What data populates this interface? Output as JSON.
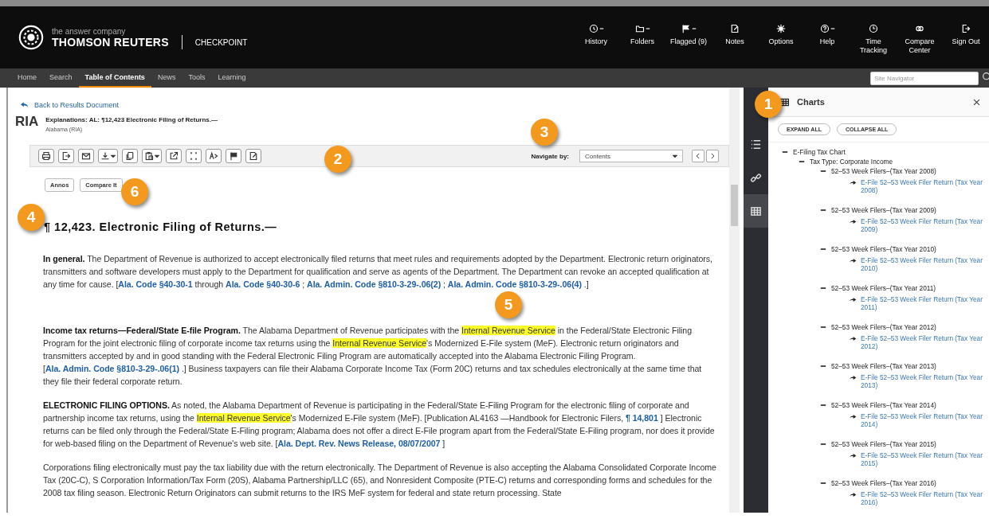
{
  "header": {
    "tagline": "the answer company",
    "brand": "THOMSON REUTERS",
    "product": "CHECKPOINT",
    "actions": [
      {
        "label": "History",
        "dropdown": true
      },
      {
        "label": "Folders",
        "dropdown": true
      },
      {
        "label": "Flagged (9)",
        "dropdown": true
      },
      {
        "label": "Notes",
        "dropdown": false
      },
      {
        "label": "Options",
        "dropdown": false
      },
      {
        "label": "Help",
        "dropdown": true
      },
      {
        "label": "Time Tracking",
        "dropdown": false
      },
      {
        "label": "Compare Center",
        "dropdown": false
      },
      {
        "label": "Sign Out",
        "dropdown": false
      }
    ]
  },
  "nav": {
    "tabs": [
      {
        "label": "Home",
        "selected": false
      },
      {
        "label": "Search",
        "selected": false
      },
      {
        "label": "Table of Contents",
        "selected": true
      },
      {
        "label": "News",
        "selected": false
      },
      {
        "label": "Tools",
        "selected": false
      },
      {
        "label": "Learning",
        "selected": false
      }
    ],
    "search": {
      "placeholder": "Site Navigator"
    }
  },
  "document": {
    "back_link": "Back to Results Document",
    "source": "RIA",
    "title": "Explanations: AL: ¶12,423 Electronic Filing of Returns.—",
    "subtitle": "Alabama (RIA)",
    "toolbar": {
      "buttons": [
        {
          "dropdown": false
        },
        {
          "dropdown": false
        },
        {
          "dropdown": false
        },
        {
          "dropdown": true
        },
        {
          "dropdown": false
        },
        {
          "dropdown": true
        },
        {
          "dropdown": false
        },
        {
          "dropdown": false
        },
        {
          "dropdown": false
        },
        {
          "dropdown": false
        },
        {
          "dropdown": false
        }
      ],
      "navigate_label": "Navigate by:",
      "navigate_value": "Contents"
    },
    "doc_buttons": [
      "Annos",
      "Compare It"
    ],
    "heading": "¶ 12,423. Electronic Filing of Returns.—",
    "paragraphs": [
      [
        {
          "kind": "bold",
          "text": "In general."
        },
        {
          "kind": "text",
          "text": " The Department of Revenue is authorized to accept electronically filed returns that meet rules and requirements adopted by the Department. Electronic return originators, transmitters and software developers must apply to the Department for qualification and serve as agents of the Department. The Department can revoke an accepted qualification at any time for cause. ["
        },
        {
          "kind": "link",
          "text": "Ala. Code §40-30-1"
        },
        {
          "kind": "text",
          "text": " through "
        },
        {
          "kind": "link",
          "text": "Ala. Code §40-30-6"
        },
        {
          "kind": "text",
          "text": " ; "
        },
        {
          "kind": "link",
          "text": "Ala. Admin. Code §810-3-29-.06(2)"
        },
        {
          "kind": "text",
          "text": " ; "
        },
        {
          "kind": "link",
          "text": "Ala. Admin. Code §810-3-29-.06(4)"
        },
        {
          "kind": "text",
          "text": " .]"
        }
      ],
      [
        {
          "kind": "bold",
          "text": "Income tax returns—Federal/State E-file Program."
        },
        {
          "kind": "text",
          "text": " The Alabama Department of Revenue participates with the "
        },
        {
          "kind": "highlight",
          "text": "Internal Revenue Service"
        },
        {
          "kind": "text",
          "text": " in the Federal/State Electronic Filing Program for the joint electronic filing of corporate income tax returns using the "
        },
        {
          "kind": "highlight",
          "text": "Internal Revenue Service"
        },
        {
          "kind": "text",
          "text": "'s Modernized E-File system (MeF). Electronic return originators and transmitters accepted by and in good standing with the Federal Electronic Filing Program are automatically accepted into the Alabama Electronic Filing Program. ["
        },
        {
          "kind": "link",
          "text": "Ala. Admin. Code §810-3-29-.06(1)"
        },
        {
          "kind": "text",
          "text": " .] Business taxpayers can file their Alabama Corporate Income Tax (Form 20C) returns and tax schedules electronically at the same time that they file their federal corporate return."
        }
      ],
      [
        {
          "kind": "bold",
          "text": "ELECTRONIC FILING OPTIONS."
        },
        {
          "kind": "text",
          "text": " As noted, the Alabama Department of Revenue is participating in the Federal/State E-Filing Program for the electronic filing of corporate and partnership income tax returns, using the "
        },
        {
          "kind": "highlight",
          "text": "Internal Revenue Service"
        },
        {
          "kind": "text",
          "text": "'s Modernized E-File system (MeF). [Publication AL4163 —Handbook for Electronic Filers, "
        },
        {
          "kind": "link",
          "text": "¶ 14,801"
        },
        {
          "kind": "text",
          "text": " ] Electronic returns can be filed only through the Federal/State E-Filing program; Alabama does not offer a direct E-File program apart from the Federal/State E-Filing program, nor does it provide for web-based filing on the Department of Revenue's web site. ["
        },
        {
          "kind": "link",
          "text": "Ala. Dept. Rev. News Release, 08/07/2007"
        },
        {
          "kind": "text",
          "text": " ]"
        }
      ],
      [
        {
          "kind": "text",
          "text": "Corporations filing electronically must pay the tax liability due with the return electronically. The Department of Revenue is also accepting the Alabama Consolidated Corporate Income Tax (20C-C), S Corporation Information/Tax Form (20S), Alabama Partnership/LLC (65), and Nonresident Composite (PTE-C) returns and corresponding forms and schedules for the 2008 tax filing season. Electronic Return Originators can submit returns to the IRS MeF system for federal and state return processing. State"
        }
      ]
    ]
  },
  "rail": {
    "items": [
      {
        "selected": false
      },
      {
        "selected": false
      },
      {
        "selected": true
      }
    ]
  },
  "panel": {
    "title": "Charts",
    "buttons": [
      "EXPAND ALL",
      "COLLAPSE ALL"
    ],
    "tree": [
      {
        "kind": "group",
        "label": "E-Filing Tax Chart",
        "expanded": true,
        "children": [
          {
            "kind": "group",
            "label": "Tax Type: Corporate Income",
            "expanded": true,
            "children": [
              {
                "kind": "group",
                "label": "52–53 Week Filers–(Tax Year 2008)",
                "expanded": true,
                "children": [
                  {
                    "kind": "link",
                    "label": "E-File 52–53 Week Filer Return (Tax Year 2008)"
                  }
                ]
              },
              {
                "kind": "group",
                "label": "52–53 Week Filers–(Tax Year 2009)",
                "expanded": true,
                "children": [
                  {
                    "kind": "link",
                    "label": "E-File 52–53 Week Filer Return (Tax Year 2009)"
                  }
                ]
              },
              {
                "kind": "group",
                "label": "52–53 Week Filers–(Tax Year 2010)",
                "expanded": true,
                "children": [
                  {
                    "kind": "link",
                    "label": "E-File 52–53 Week Filer Return (Tax Year 2010)"
                  }
                ]
              },
              {
                "kind": "group",
                "label": "52–53 Week Filers–(Tax Year 2011)",
                "expanded": true,
                "children": [
                  {
                    "kind": "link",
                    "label": "E-File 52–53 Week Filer Return (Tax Year 2011)"
                  }
                ]
              },
              {
                "kind": "group",
                "label": "52–53 Week Filers–(Tax Year 2012)",
                "expanded": true,
                "children": [
                  {
                    "kind": "link",
                    "label": "E-File 52–53 Week Filer Return (Tax Year 2012)"
                  }
                ]
              },
              {
                "kind": "group",
                "label": "52–53 Week Filers–(Tax Year 2013)",
                "expanded": true,
                "children": [
                  {
                    "kind": "link",
                    "label": "E-File 52–53 Week Filer Return (Tax Year 2013)"
                  }
                ]
              },
              {
                "kind": "group",
                "label": "52–53 Week Filers–(Tax Year 2014)",
                "expanded": true,
                "children": [
                  {
                    "kind": "link",
                    "label": "E-File 52–53 Week Filer Return (Tax Year 2014)"
                  }
                ]
              },
              {
                "kind": "group",
                "label": "52–53 Week Filers–(Tax Year 2015)",
                "expanded": true,
                "children": [
                  {
                    "kind": "link",
                    "label": "E-File 52–53 Week Filer Return (Tax Year 2015)"
                  }
                ]
              },
              {
                "kind": "group",
                "label": "52–53 Week Filers–(Tax Year 2016)",
                "expanded": true,
                "children": [
                  {
                    "kind": "link",
                    "label": "E-File 52–53 Week Filer Return (Tax Year 2016)"
                  }
                ]
              }
            ]
          }
        ]
      }
    ]
  },
  "callouts": [
    "1",
    "2",
    "3",
    "4",
    "5",
    "6"
  ]
}
